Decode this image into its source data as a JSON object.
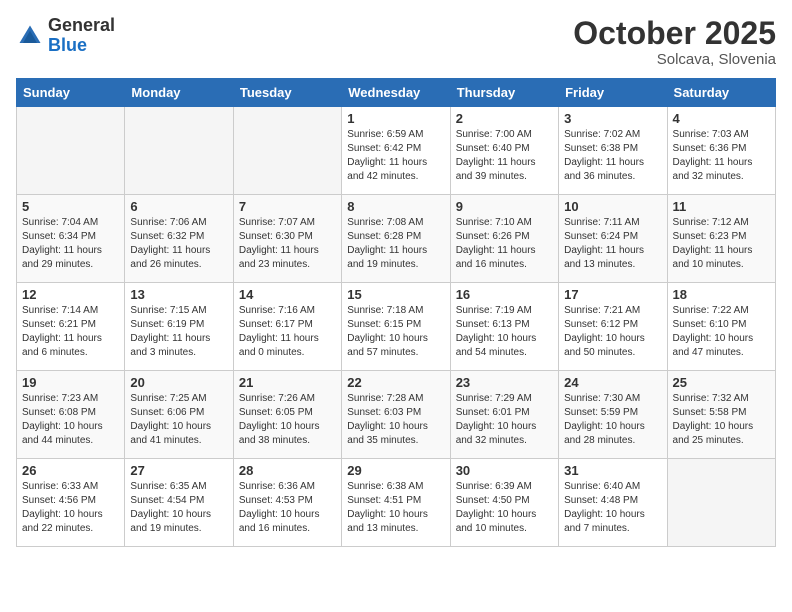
{
  "header": {
    "logo_general": "General",
    "logo_blue": "Blue",
    "month_title": "October 2025",
    "subtitle": "Solcava, Slovenia"
  },
  "days_of_week": [
    "Sunday",
    "Monday",
    "Tuesday",
    "Wednesday",
    "Thursday",
    "Friday",
    "Saturday"
  ],
  "weeks": [
    [
      {
        "day": "",
        "text": ""
      },
      {
        "day": "",
        "text": ""
      },
      {
        "day": "",
        "text": ""
      },
      {
        "day": "1",
        "text": "Sunrise: 6:59 AM\nSunset: 6:42 PM\nDaylight: 11 hours\nand 42 minutes."
      },
      {
        "day": "2",
        "text": "Sunrise: 7:00 AM\nSunset: 6:40 PM\nDaylight: 11 hours\nand 39 minutes."
      },
      {
        "day": "3",
        "text": "Sunrise: 7:02 AM\nSunset: 6:38 PM\nDaylight: 11 hours\nand 36 minutes."
      },
      {
        "day": "4",
        "text": "Sunrise: 7:03 AM\nSunset: 6:36 PM\nDaylight: 11 hours\nand 32 minutes."
      }
    ],
    [
      {
        "day": "5",
        "text": "Sunrise: 7:04 AM\nSunset: 6:34 PM\nDaylight: 11 hours\nand 29 minutes."
      },
      {
        "day": "6",
        "text": "Sunrise: 7:06 AM\nSunset: 6:32 PM\nDaylight: 11 hours\nand 26 minutes."
      },
      {
        "day": "7",
        "text": "Sunrise: 7:07 AM\nSunset: 6:30 PM\nDaylight: 11 hours\nand 23 minutes."
      },
      {
        "day": "8",
        "text": "Sunrise: 7:08 AM\nSunset: 6:28 PM\nDaylight: 11 hours\nand 19 minutes."
      },
      {
        "day": "9",
        "text": "Sunrise: 7:10 AM\nSunset: 6:26 PM\nDaylight: 11 hours\nand 16 minutes."
      },
      {
        "day": "10",
        "text": "Sunrise: 7:11 AM\nSunset: 6:24 PM\nDaylight: 11 hours\nand 13 minutes."
      },
      {
        "day": "11",
        "text": "Sunrise: 7:12 AM\nSunset: 6:23 PM\nDaylight: 11 hours\nand 10 minutes."
      }
    ],
    [
      {
        "day": "12",
        "text": "Sunrise: 7:14 AM\nSunset: 6:21 PM\nDaylight: 11 hours\nand 6 minutes."
      },
      {
        "day": "13",
        "text": "Sunrise: 7:15 AM\nSunset: 6:19 PM\nDaylight: 11 hours\nand 3 minutes."
      },
      {
        "day": "14",
        "text": "Sunrise: 7:16 AM\nSunset: 6:17 PM\nDaylight: 11 hours\nand 0 minutes."
      },
      {
        "day": "15",
        "text": "Sunrise: 7:18 AM\nSunset: 6:15 PM\nDaylight: 10 hours\nand 57 minutes."
      },
      {
        "day": "16",
        "text": "Sunrise: 7:19 AM\nSunset: 6:13 PM\nDaylight: 10 hours\nand 54 minutes."
      },
      {
        "day": "17",
        "text": "Sunrise: 7:21 AM\nSunset: 6:12 PM\nDaylight: 10 hours\nand 50 minutes."
      },
      {
        "day": "18",
        "text": "Sunrise: 7:22 AM\nSunset: 6:10 PM\nDaylight: 10 hours\nand 47 minutes."
      }
    ],
    [
      {
        "day": "19",
        "text": "Sunrise: 7:23 AM\nSunset: 6:08 PM\nDaylight: 10 hours\nand 44 minutes."
      },
      {
        "day": "20",
        "text": "Sunrise: 7:25 AM\nSunset: 6:06 PM\nDaylight: 10 hours\nand 41 minutes."
      },
      {
        "day": "21",
        "text": "Sunrise: 7:26 AM\nSunset: 6:05 PM\nDaylight: 10 hours\nand 38 minutes."
      },
      {
        "day": "22",
        "text": "Sunrise: 7:28 AM\nSunset: 6:03 PM\nDaylight: 10 hours\nand 35 minutes."
      },
      {
        "day": "23",
        "text": "Sunrise: 7:29 AM\nSunset: 6:01 PM\nDaylight: 10 hours\nand 32 minutes."
      },
      {
        "day": "24",
        "text": "Sunrise: 7:30 AM\nSunset: 5:59 PM\nDaylight: 10 hours\nand 28 minutes."
      },
      {
        "day": "25",
        "text": "Sunrise: 7:32 AM\nSunset: 5:58 PM\nDaylight: 10 hours\nand 25 minutes."
      }
    ],
    [
      {
        "day": "26",
        "text": "Sunrise: 6:33 AM\nSunset: 4:56 PM\nDaylight: 10 hours\nand 22 minutes."
      },
      {
        "day": "27",
        "text": "Sunrise: 6:35 AM\nSunset: 4:54 PM\nDaylight: 10 hours\nand 19 minutes."
      },
      {
        "day": "28",
        "text": "Sunrise: 6:36 AM\nSunset: 4:53 PM\nDaylight: 10 hours\nand 16 minutes."
      },
      {
        "day": "29",
        "text": "Sunrise: 6:38 AM\nSunset: 4:51 PM\nDaylight: 10 hours\nand 13 minutes."
      },
      {
        "day": "30",
        "text": "Sunrise: 6:39 AM\nSunset: 4:50 PM\nDaylight: 10 hours\nand 10 minutes."
      },
      {
        "day": "31",
        "text": "Sunrise: 6:40 AM\nSunset: 4:48 PM\nDaylight: 10 hours\nand 7 minutes."
      },
      {
        "day": "",
        "text": ""
      }
    ]
  ]
}
